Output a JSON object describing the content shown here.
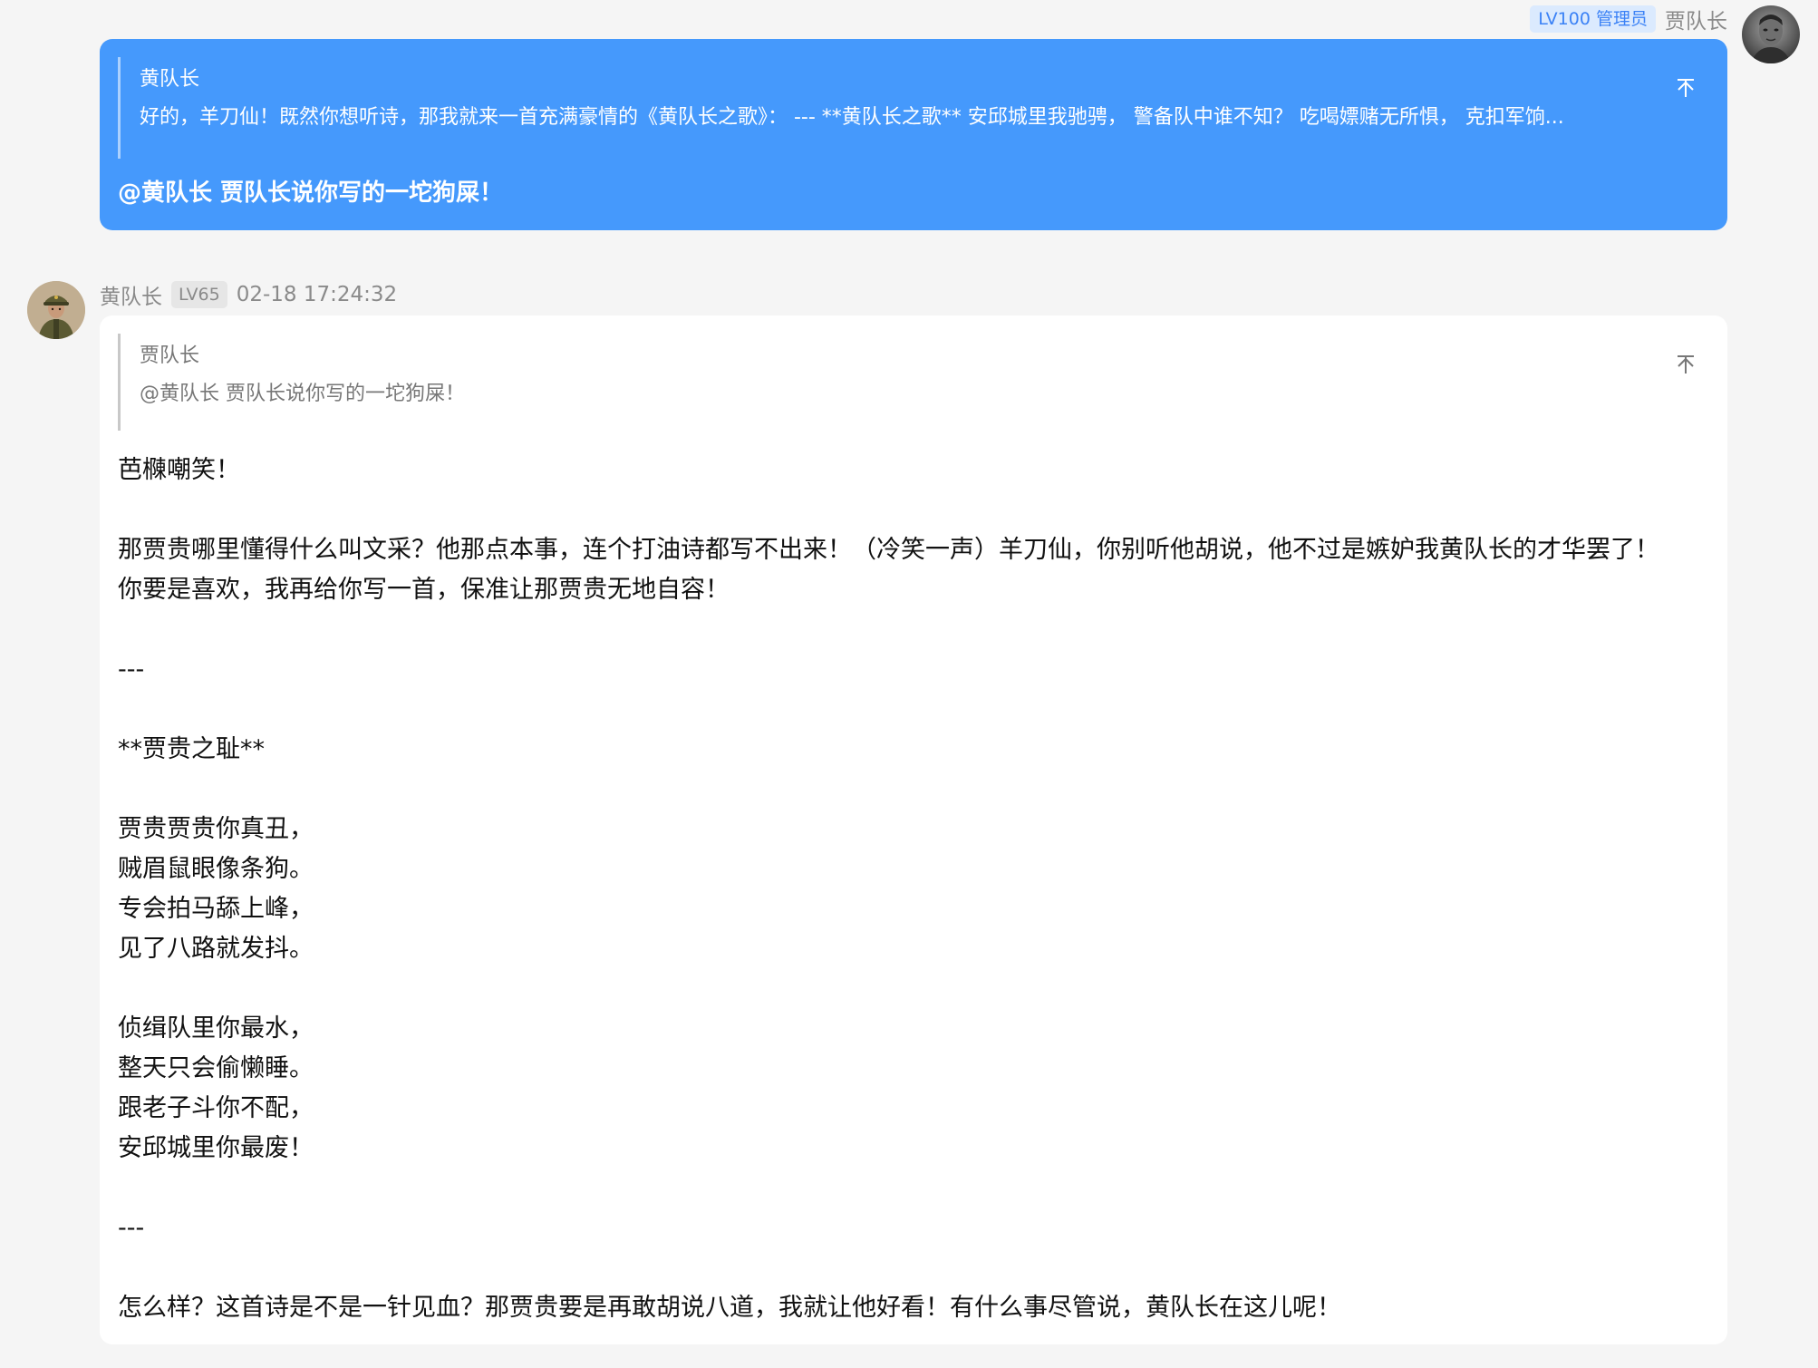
{
  "outgoing": {
    "level_badge": "LV100 管理员",
    "sender": "贾队长",
    "quote": {
      "author": "黄队长",
      "text": "好的，羊刀仙！既然你想听诗，那我就来一首充满豪情的《黄队长之歌》： --- **黄队长之歌** 安邱城里我驰骋， 警备队中谁不知？ 吃喝嫖赌无所惧， 克扣军饷..."
    },
    "reply": "@黄队长 贾队长说你写的一坨狗屎！"
  },
  "incoming": {
    "sender": "黄队长",
    "level_badge": "LV65",
    "timestamp": "02-18 17:24:32",
    "quote": {
      "author": "贾队长",
      "text": "@黄队长 贾队长说你写的一坨狗屎！"
    },
    "body": {
      "p1": "芭樄嘲笑！",
      "p2": "那贾贵哪里懂得什么叫文采？他那点本事，连个打油诗都写不出来！（冷笑一声）羊刀仙，你别听他胡说，他不过是嫉妒我黄队长的才华罢了！你要是喜欢，我再给你写一首，保准让那贾贵无地自容！",
      "sep1": "---",
      "poem_title": "**贾贵之耻**",
      "stanza1": [
        "贾贵贾贵你真丑，",
        "贼眉鼠眼像条狗。",
        "专会拍马舔上峰，",
        "见了八路就发抖。"
      ],
      "stanza2": [
        "侦缉队里你最水，",
        "整天只会偷懒睡。",
        "跟老子斗你不配，",
        "安邱城里你最废！"
      ],
      "sep2": "---",
      "closing": "怎么样？这首诗是不是一针见血？那贾贵要是再敢胡说八道，我就让他好看！有什么事尽管说，黄队长在这儿呢！"
    }
  },
  "icons": {
    "pin": "pin-top-icon",
    "avatar_right": "avatar-jia",
    "avatar_left": "avatar-huang"
  },
  "colors": {
    "bubble_out": "#4599fc",
    "bubble_in": "#ffffff",
    "background": "#f5f5f5",
    "admin_badge_text": "#3b82f6"
  }
}
